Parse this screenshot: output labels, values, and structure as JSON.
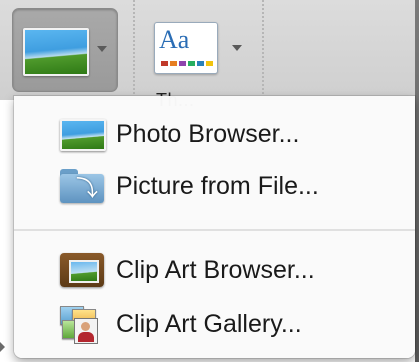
{
  "toolbar": {
    "picture_button": {
      "icon": "photo-icon"
    },
    "themes_button": {
      "icon_text": "Aa",
      "label": "Th..."
    }
  },
  "menu": {
    "items": [
      {
        "label": "Photo Browser...",
        "icon": "photo-browser-icon"
      },
      {
        "label": "Picture from File...",
        "icon": "folder-arrow-icon"
      },
      {
        "label": "Clip Art Browser...",
        "icon": "clip-art-browser-icon"
      },
      {
        "label": "Clip Art Gallery...",
        "icon": "clip-art-gallery-icon"
      }
    ]
  },
  "colors": {
    "menu_background": "#fafafa",
    "toolbar_background": "#d6d6d6",
    "pressed_button": "#a0a0a0",
    "text": "#1a1a1a"
  }
}
